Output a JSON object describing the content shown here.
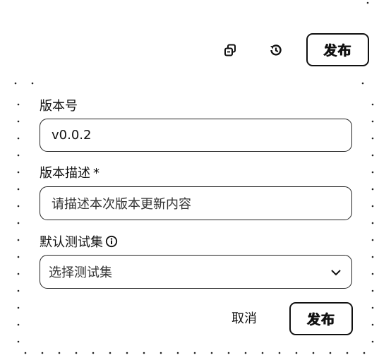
{
  "toolbar": {
    "copy_icon": "copy-icon",
    "history_icon": "history-icon",
    "publish_label": "发布"
  },
  "form": {
    "version": {
      "label": "版本号",
      "value": "v0.0.2"
    },
    "description": {
      "label": "版本描述",
      "required_mark": "*",
      "placeholder": "请描述本次版本更新内容"
    },
    "testset": {
      "label": "默认测试集",
      "info_icon": "info-icon",
      "placeholder": "选择测试集",
      "chevron_icon": "chevron-down-icon"
    }
  },
  "footer": {
    "cancel_label": "取消",
    "publish_label": "发布"
  }
}
